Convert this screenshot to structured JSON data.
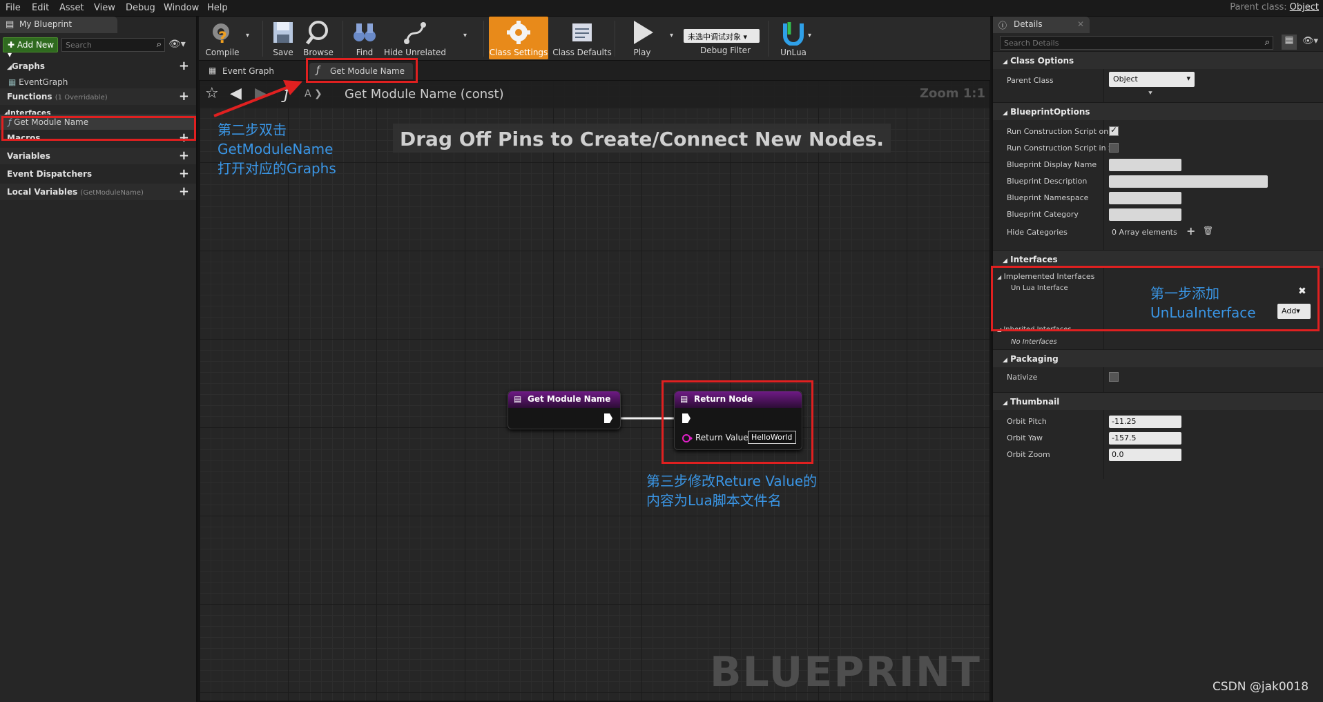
{
  "menu": [
    "File",
    "Edit",
    "Asset",
    "View",
    "Debug",
    "Window",
    "Help"
  ],
  "parent_class": {
    "label": "Parent class:",
    "value": "Object"
  },
  "left_panel": {
    "tab": "My Blueprint",
    "add_new": "Add New",
    "search_placeholder": "Search",
    "graphs": "Graphs",
    "event_graph": "EventGraph",
    "functions": "Functions",
    "functions_sub": "(1 Overridable)",
    "interfaces": "Interfaces",
    "interface_item": "Get Module Name",
    "macros": "Macros",
    "variables": "Variables",
    "event_dispatchers": "Event Dispatchers",
    "local_variables": "Local Variables",
    "local_variables_sub": "(GetModuleName)"
  },
  "toolbar": {
    "compile": "Compile",
    "save": "Save",
    "browse": "Browse",
    "find": "Find",
    "hide_unrelated": "Hide Unrelated",
    "class_settings": "Class Settings",
    "class_defaults": "Class Defaults",
    "play": "Play",
    "debug_dropdown": "未选中调试对象",
    "debug_filter": "Debug Filter",
    "unlua": "UnLua"
  },
  "graph_tabs": [
    "Event Graph",
    "Get Module Name"
  ],
  "graph": {
    "breadcrumb": "Get Module Name (const)",
    "zoom": "Zoom 1:1",
    "hint": "Drag Off Pins to Create/Connect New Nodes.",
    "watermark": "BLUEPRINT",
    "node_entry": "Get Module Name",
    "node_return": "Return Node",
    "return_value_label": "Return Value",
    "return_value": "HelloWorld"
  },
  "details": {
    "tab": "Details",
    "search_placeholder": "Search Details",
    "class_options": "Class Options",
    "parent_class_label": "Parent Class",
    "parent_class_value": "Object",
    "blueprint_options": "BlueprintOptions",
    "run_cs_1": "Run Construction Script on D",
    "run_cs_2": "Run Construction Script in Se",
    "display_name": "Blueprint Display Name",
    "description": "Blueprint Description",
    "namespace": "Blueprint Namespace",
    "category": "Blueprint Category",
    "hide_categories": "Hide Categories",
    "array_elements": "0 Array elements",
    "interfaces": "Interfaces",
    "implemented": "Implemented Interfaces",
    "unlua_interface": "Un Lua Interface",
    "add": "Add",
    "inherited": "Inherited Interfaces",
    "no_interfaces": "No Interfaces",
    "packaging": "Packaging",
    "nativize": "Nativize",
    "thumbnail": "Thumbnail",
    "orbit_pitch": "Orbit Pitch",
    "orbit_pitch_v": "-11.25",
    "orbit_yaw": "Orbit Yaw",
    "orbit_yaw_v": "-157.5",
    "orbit_zoom": "Orbit Zoom",
    "orbit_zoom_v": "0.0"
  },
  "annotations": {
    "step2": [
      "第二步双击",
      "GetModuleName",
      "打开对应的Graphs"
    ],
    "step1": [
      "第一步添加",
      "UnLuaInterface"
    ],
    "step3": [
      "第三步修改Reture Value的",
      "内容为Lua脚本文件名"
    ],
    "credit": "CSDN @jak0018"
  },
  "colors": {
    "accent_orange": "#e88a1a",
    "annotation_red": "#e02020",
    "annotation_blue": "#3a96e6",
    "node_purple": "#6e1a85"
  }
}
